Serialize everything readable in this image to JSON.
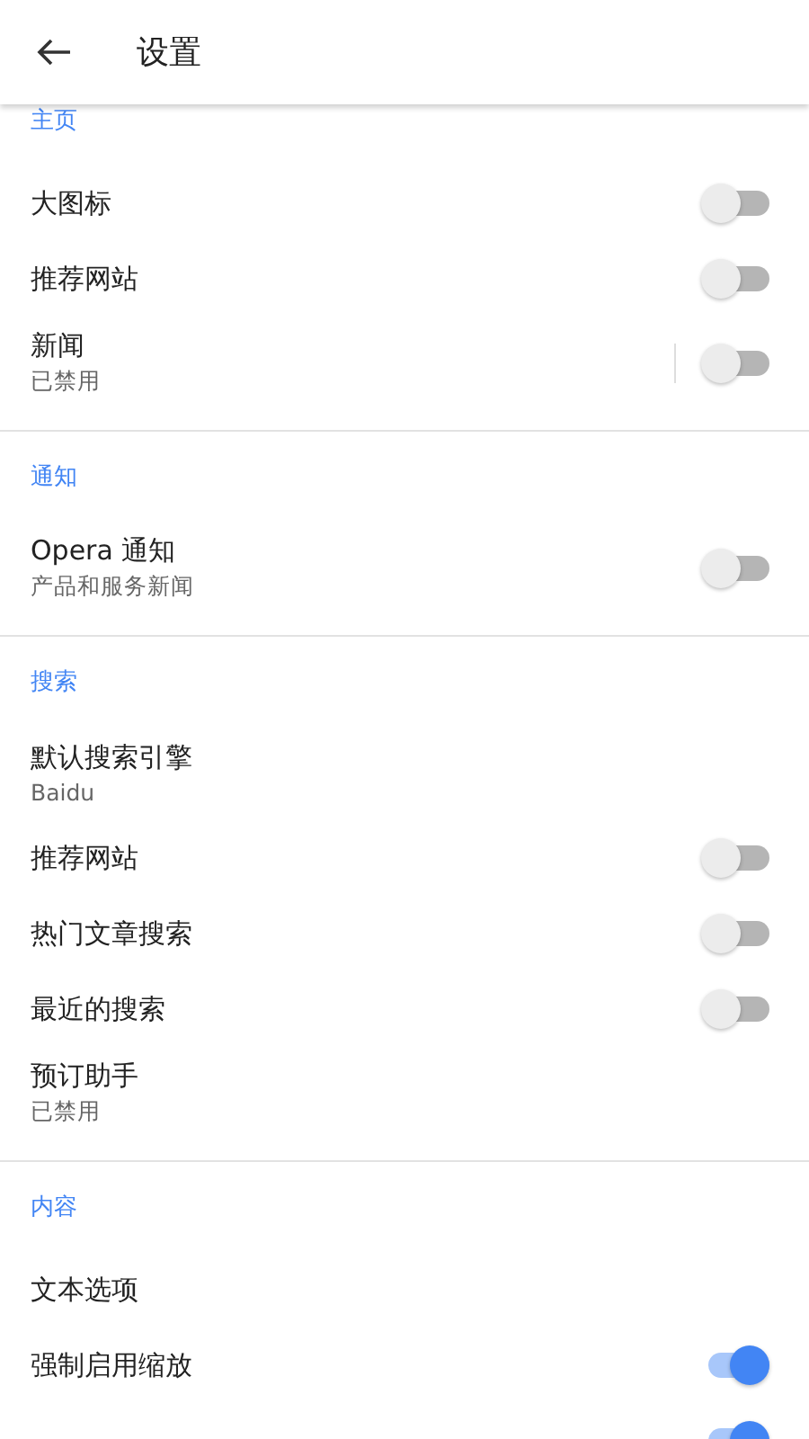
{
  "app_bar": {
    "title": "设置"
  },
  "sections": [
    {
      "title": "主页",
      "items": [
        {
          "label": "大图标",
          "kind": "toggle",
          "on": false,
          "separator": false
        },
        {
          "label": "推荐网站",
          "kind": "toggle",
          "on": false,
          "separator": false
        },
        {
          "label": "新闻",
          "subtitle": "已禁用",
          "kind": "toggle",
          "on": false,
          "separator": true
        }
      ]
    },
    {
      "title": "通知",
      "items": [
        {
          "label": "Opera 通知",
          "subtitle": "产品和服务新闻",
          "kind": "toggle",
          "on": false,
          "separator": false
        }
      ]
    },
    {
      "title": "搜索",
      "items": [
        {
          "label": "默认搜索引擎",
          "subtitle": "Baidu",
          "kind": "link"
        },
        {
          "label": "推荐网站",
          "kind": "toggle",
          "on": false,
          "separator": false
        },
        {
          "label": "热门文章搜索",
          "kind": "toggle",
          "on": false,
          "separator": false
        },
        {
          "label": "最近的搜索",
          "kind": "toggle",
          "on": false,
          "separator": false
        },
        {
          "label": "预订助手",
          "subtitle": "已禁用",
          "kind": "link"
        }
      ]
    },
    {
      "title": "内容",
      "items": [
        {
          "label": "文本选项",
          "kind": "link"
        },
        {
          "label": "强制启用缩放",
          "kind": "toggle",
          "on": true,
          "separator": false
        },
        {
          "kind": "toggle",
          "on": true,
          "separator": false
        }
      ]
    }
  ]
}
